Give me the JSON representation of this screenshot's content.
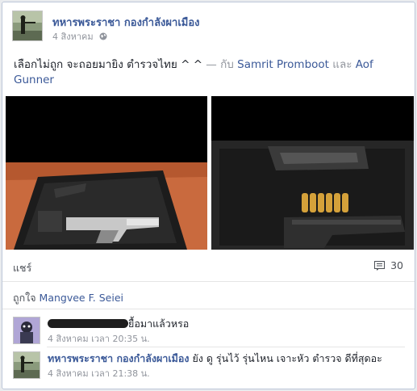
{
  "post": {
    "author": "ทหารพระราชา กองกำลังผาเมือง",
    "date": "4 สิงหาคม",
    "text": "เลือกไม่ถูก จะถอยมายิง ตำรวจไทย ^ ^",
    "with_sep": " — กับ ",
    "tag1": "Samrit Promboot",
    "and": " และ ",
    "tag2": "Aof Gunner"
  },
  "actions": {
    "share_label": "แชร์",
    "comment_count": "30"
  },
  "likes": {
    "prefix": "ถูกใจ ",
    "name": "Mangvee F. Seiei"
  },
  "comments": [
    {
      "text": "ยื้อมาแล้วหรอ",
      "time": "4 สิงหาคม เวลา 20:35 น."
    },
    {
      "author": "ทหารพระราชา กองกำลังผาเมือง",
      "text": " ยัง ดู รุ่นไว้ รุ่นไหน เจาะหัว ตำรวจ ดีที่สุดอะ",
      "time": "4 สิงหาคม เวลา 21:38 น."
    }
  ],
  "colors": {
    "link": "#3b5998",
    "muted": "#90949c"
  }
}
